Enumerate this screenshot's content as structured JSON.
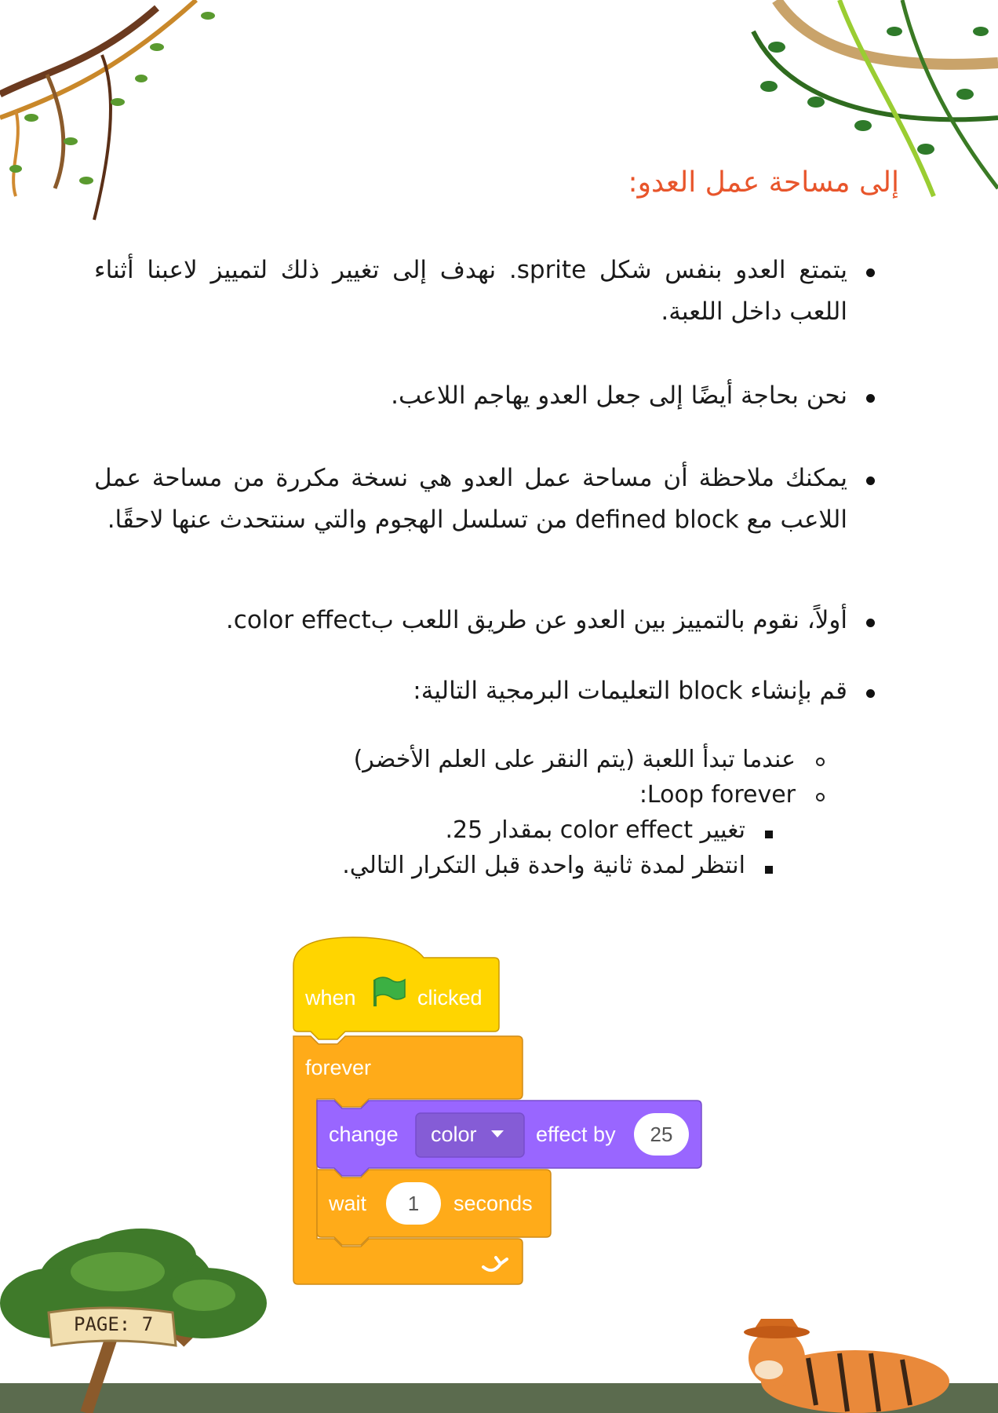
{
  "heading": "إلى مساحة عمل العدو:",
  "bullets": [
    "يتمتع العدو بنفس شكل sprite. نهدف إلى تغيير ذلك لتمييز لاعبنا أثناء اللعب داخل اللعبة.",
    "نحن بحاجة أيضًا إلى جعل العدو يهاجم اللاعب.",
    "يمكنك ملاحظة أن مساحة عمل العدو هي نسخة مكررة من مساحة عمل اللاعب مع defined block من تسلسل الهجوم والتي سنتحدث عنها لاحقًا.",
    "أولاً، نقوم بالتمييز بين العدو عن طريق اللعب بcolor effect.",
    "قم بإنشاء block التعليمات البرمجية التالية:"
  ],
  "sub_items": [
    "عندما تبدأ اللعبة (يتم النقر على العلم الأخضر)",
    "Loop forever:"
  ],
  "sub_sub_items": [
    "تغيير color effect بمقدار 25.",
    "انتظر لمدة ثانية واحدة قبل التكرار التالي."
  ],
  "scratch": {
    "when": "when",
    "clicked": "clicked",
    "forever": "forever",
    "change": "change",
    "color": "color",
    "effect_by": "effect by",
    "effect_value": "25",
    "wait": "wait",
    "wait_value": "1",
    "seconds": "seconds",
    "colors": {
      "events": "#FFD500",
      "control": "#FFAB19",
      "looks": "#9966FF",
      "flag": "#3CB043"
    }
  },
  "page_label": "PAGE: 7",
  "colors": {
    "heading": "#E8552B",
    "ground": "#5B6B4E"
  }
}
